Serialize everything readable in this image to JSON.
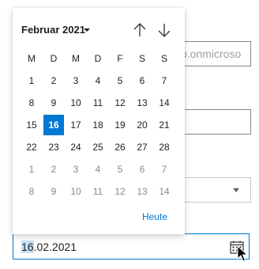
{
  "background_form": {
    "email_partial": "p.onmicroso"
  },
  "date_input": {
    "value_selected": "16",
    "value_rest": ".02.2021",
    "calendar_icon": "calendar-icon"
  },
  "calendar": {
    "month_label": "Februar 2021",
    "nav_up_icon": "arrow-up-icon",
    "nav_down_icon": "arrow-down-icon",
    "weekdays": [
      "M",
      "D",
      "M",
      "D",
      "F",
      "S",
      "S"
    ],
    "weeks": [
      [
        "1",
        "2",
        "3",
        "4",
        "5",
        "6",
        "7"
      ],
      [
        "8",
        "9",
        "10",
        "11",
        "12",
        "13",
        "14"
      ],
      [
        "15",
        "16",
        "17",
        "18",
        "19",
        "20",
        "21"
      ],
      [
        "22",
        "23",
        "24",
        "25",
        "26",
        "27",
        "28"
      ],
      [
        "1",
        "2",
        "3",
        "4",
        "5",
        "6",
        "7"
      ],
      [
        "8",
        "9",
        "10",
        "11",
        "12",
        "13",
        "14"
      ]
    ],
    "other_month_weeks": [
      4,
      5
    ],
    "selected_day": "16",
    "today_label": "Heute"
  },
  "colors": {
    "accent": "#0078d4",
    "selected_text": "#ffffff",
    "muted_text": "#8a8886"
  }
}
